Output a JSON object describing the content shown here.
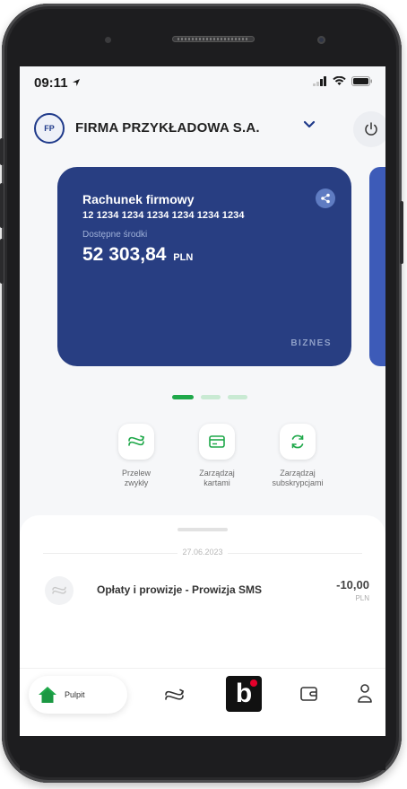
{
  "statusbar": {
    "time": "09:11",
    "icons": [
      "location-arrow-icon",
      "signal-icon",
      "wifi-icon",
      "battery-icon"
    ]
  },
  "header": {
    "initials": "FP",
    "company": "FIRMA PRZYKŁADOWA S.A.",
    "icons": [
      "chevron-down-icon",
      "power-icon"
    ]
  },
  "account_card": {
    "title": "Rachunek firmowy",
    "number": "12 1234 1234 1234 1234 1234 1234",
    "available_label": "Dostępne środki",
    "balance": "52 303,84",
    "currency": "PLN",
    "badge": "BIZNES",
    "color": "#283e82"
  },
  "pager": {
    "count": 3,
    "active": 0
  },
  "actions": [
    {
      "label_line1": "Przelew",
      "label_line2": "zwykły",
      "icon": "transfer-icon"
    },
    {
      "label_line1": "Zarządzaj",
      "label_line2": "kartami",
      "icon": "card-icon"
    },
    {
      "label_line1": "Zarządzaj",
      "label_line2": "subskrypcjami",
      "icon": "subscription-icon"
    }
  ],
  "history": {
    "date": "27.06.2023",
    "transactions": [
      {
        "title": "Opłaty i prowizje - Prowizja SMS",
        "amount": "-10,00",
        "currency": "PLN",
        "icon": "transfer-icon"
      }
    ]
  },
  "navbar": {
    "home_label": "Pulpit",
    "items": [
      "home-icon",
      "transfer-icon",
      "blik-icon",
      "wallet-icon",
      "profile-icon"
    ],
    "blik_letter": "b",
    "accent": "#1fa84a"
  }
}
